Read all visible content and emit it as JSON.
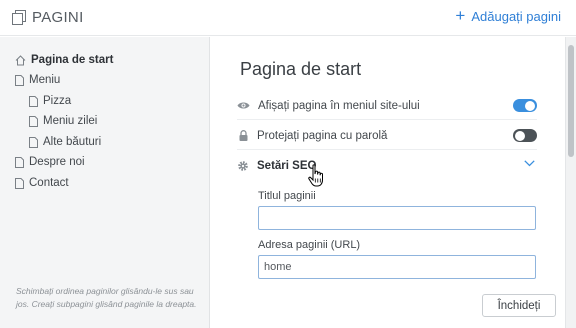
{
  "header": {
    "title": "PAGINI",
    "add_label": "Adăugați pagini"
  },
  "sidebar": {
    "items": [
      {
        "label": "Pagina de start",
        "icon": "home-icon",
        "active": true
      },
      {
        "label": "Meniu",
        "icon": "page-icon"
      },
      {
        "label": "Pizza",
        "icon": "page-icon"
      },
      {
        "label": "Meniu zilei",
        "icon": "page-icon"
      },
      {
        "label": "Alte băuturi",
        "icon": "page-icon"
      },
      {
        "label": "Despre noi",
        "icon": "page-icon"
      },
      {
        "label": "Contact",
        "icon": "page-icon"
      }
    ],
    "hint": "Schimbați ordinea paginilor glisându-le sus sau jos. Creați subpagini glisând paginile la dreapta."
  },
  "main": {
    "page_title": "Pagina de start",
    "show_in_menu": {
      "label": "Afișați pagina în meniul site-ului",
      "icon": "eye-icon",
      "enabled": true
    },
    "password_protect": {
      "label": "Protejați pagina cu parolă",
      "icon": "lock-icon",
      "enabled": false
    },
    "seo": {
      "label": "Setări SEO",
      "icon": "gear-icon",
      "title_field": {
        "label": "Titlul paginii",
        "value": ""
      },
      "url_field": {
        "label": "Adresa paginii (URL)",
        "value": "home"
      }
    },
    "close_label": "Închideți"
  },
  "colors": {
    "accent": "#3a8fde",
    "link": "#2f7fd6",
    "toggle_off": "#4c5257",
    "sidebar_bg": "#f4f5f6"
  }
}
